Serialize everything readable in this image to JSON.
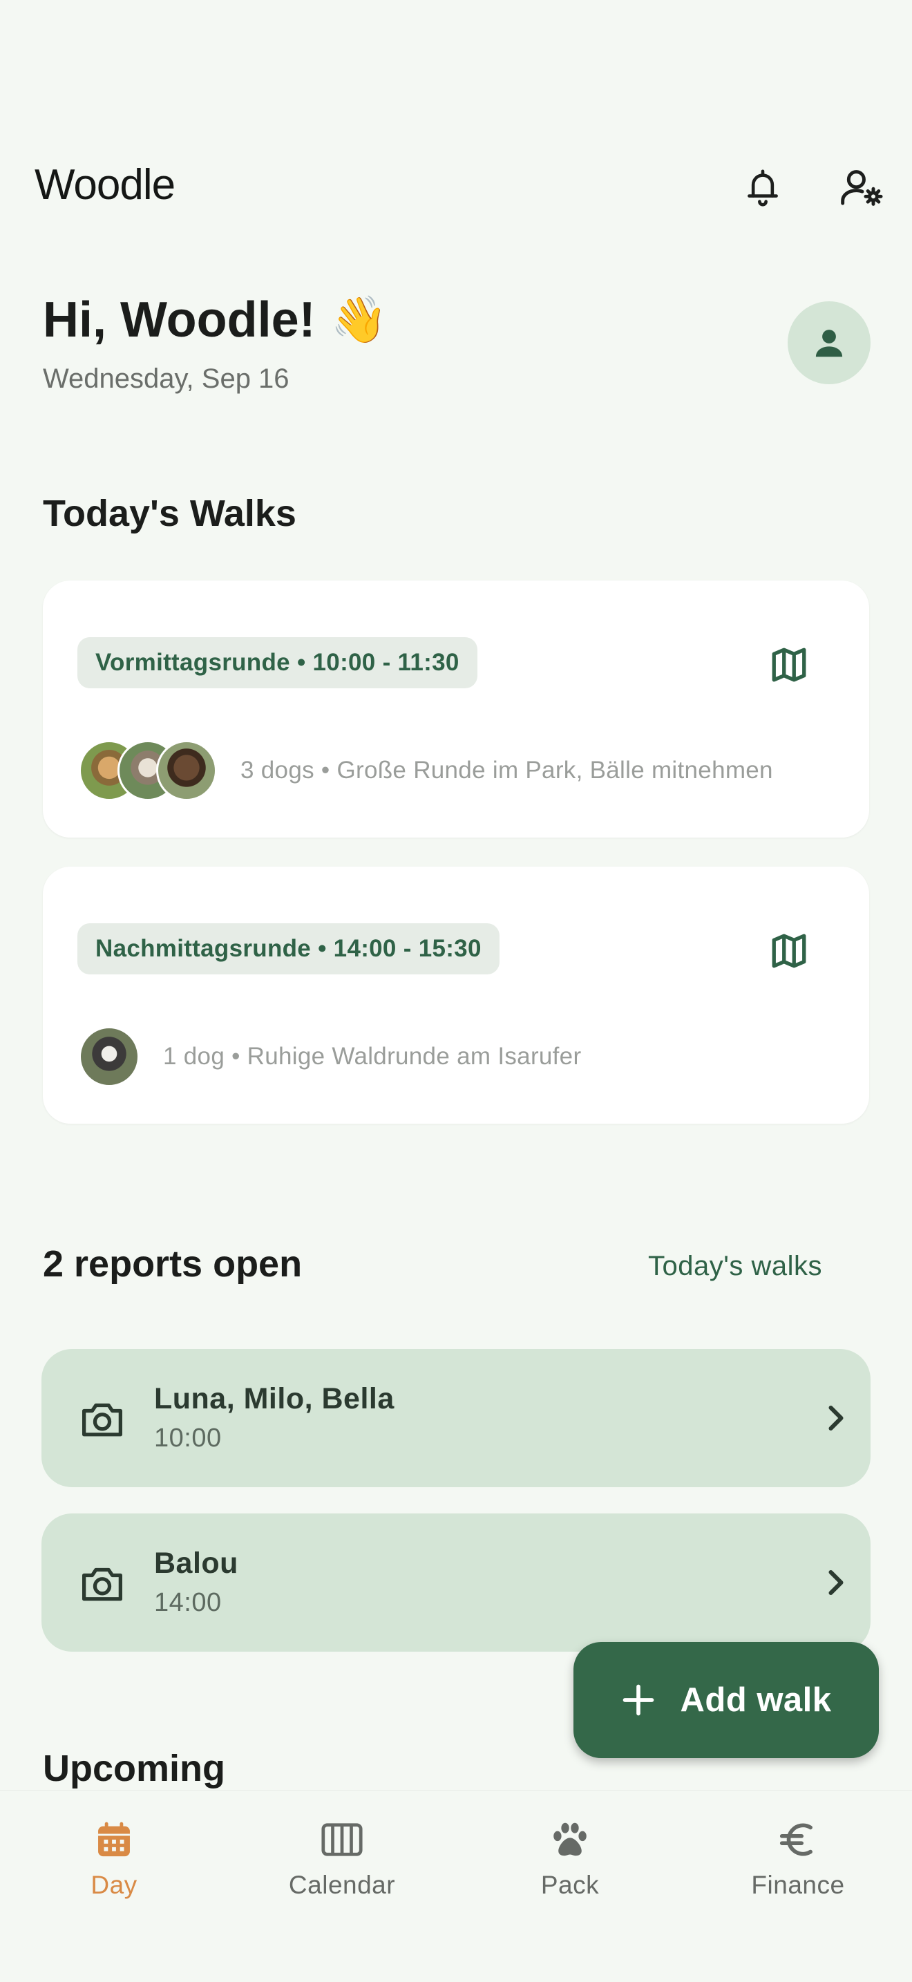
{
  "app": {
    "title": "Woodle"
  },
  "greeting": {
    "text": "Hi, Woodle!",
    "emoji": "👋",
    "date": "Wednesday, Sep 16"
  },
  "walks_section": {
    "title": "Today's Walks",
    "walks": [
      {
        "chip": "Vormittagsrunde • 10:00 - 11:30",
        "meta": "3 dogs • Große Runde im Park, Bälle mitnehmen",
        "dog_count": 3
      },
      {
        "chip": "Nachmittagsrunde • 14:00 - 15:30",
        "meta": "1 dog • Ruhige Waldrunde am Isarufer",
        "dog_count": 1
      }
    ]
  },
  "reports_section": {
    "title": "2 reports open",
    "link": "Today's walks",
    "reports": [
      {
        "name": "Luna, Milo, Bella",
        "time": "10:00"
      },
      {
        "name": "Balou",
        "time": "14:00"
      }
    ]
  },
  "upcoming": {
    "title": "Upcoming"
  },
  "fab": {
    "label": "Add walk"
  },
  "nav": {
    "items": [
      {
        "label": "Day",
        "icon": "calendar-day-icon",
        "active": true
      },
      {
        "label": "Calendar",
        "icon": "calendar-week-icon",
        "active": false
      },
      {
        "label": "Pack",
        "icon": "paw-icon",
        "active": false
      },
      {
        "label": "Finance",
        "icon": "euro-icon",
        "active": false
      }
    ]
  },
  "colors": {
    "background": "#f4f8f3",
    "primary": "#346849",
    "primary_light": "#d4e5d6",
    "active_nav": "#d98a45",
    "chip_bg": "#e6ece6"
  }
}
